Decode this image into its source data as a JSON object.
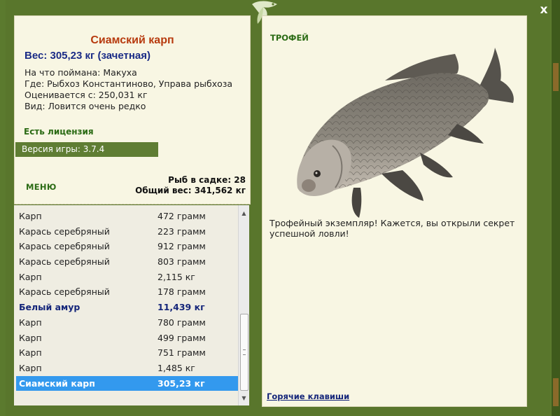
{
  "close_label": "x",
  "fish": {
    "title": "Сиамский карп",
    "weight_line": "Вес: 305,23 кг (зачетная)",
    "details": [
      "На что поймана: Макуха",
      "Где: Рыбхоз Константиново, Управа рыбхоза",
      "Оценивается с: 250,031 кг",
      "Вид: Ловится очень редко"
    ]
  },
  "license": "Есть лицензия",
  "version": "Версия игры: 3.7.4",
  "menu_label": "МЕНЮ",
  "stats": {
    "count": "Рыб в садке: 28",
    "total": "Общий вес: 341,562 кг"
  },
  "catch_list": [
    {
      "name": "Карп",
      "weight": "472 грамм"
    },
    {
      "name": "Карась серебряный",
      "weight": "223 грамм"
    },
    {
      "name": "Карась серебряный",
      "weight": "912 грамм"
    },
    {
      "name": "Карась серебряный",
      "weight": "803 грамм"
    },
    {
      "name": "Карп",
      "weight": "2,115 кг"
    },
    {
      "name": "Карась серебряный",
      "weight": "178 грамм"
    },
    {
      "name": "Белый амур",
      "weight": "11,439 кг"
    },
    {
      "name": "Карп",
      "weight": "780 грамм"
    },
    {
      "name": "Карп",
      "weight": "499 грамм"
    },
    {
      "name": "Карп",
      "weight": "751 грамм"
    },
    {
      "name": "Карп",
      "weight": "1,485 кг"
    },
    {
      "name": "Сиамский карп",
      "weight": "305,23 кг"
    }
  ],
  "trophy": {
    "title": "ТРОФЕЙ",
    "text": "Трофейный экземпляр! Кажется, вы открыли секрет успешной ловли!",
    "hotkeys": "Горячие клавиши"
  },
  "colors": {
    "frame": "#59762c",
    "panel": "#f8f6e3",
    "accent_title": "#b73a0e",
    "accent_blue": "#1a2b86",
    "green_text": "#2b6b14",
    "selection": "#3399ee"
  }
}
